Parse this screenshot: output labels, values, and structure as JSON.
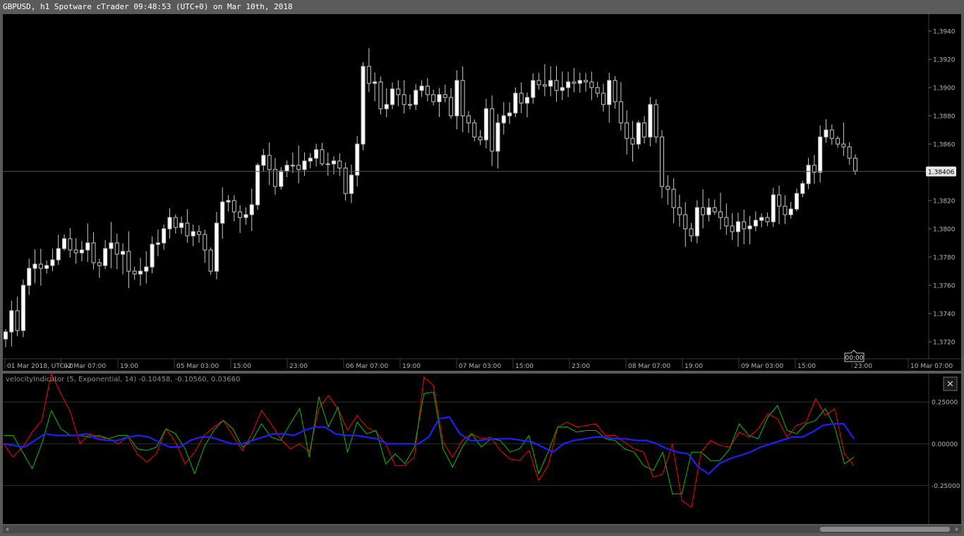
{
  "window": {
    "title": "GBPUSD, h1 Spotware cTrader 09:48:53 (UTC+0) on Mar 10th, 2018"
  },
  "colors": {
    "background": "#000000",
    "frame": "#5a5a5a",
    "candle_up": "#ffffff",
    "candle_down": "#000000",
    "wick": "#c8c8c8",
    "axis_text": "#b4b4b4",
    "fast_line": "#ff0000",
    "slow_line": "#00c000",
    "signal_line": "#1e1eff"
  },
  "chart_data": [
    {
      "type": "candlestick",
      "symbol": "GBPUSD",
      "timeframe": "h1",
      "ylim": [
        1.3708,
        1.3952
      ],
      "y_ticks": [
        "1,3720",
        "1,3740",
        "1,3760",
        "1,3780",
        "1,3800",
        "1,3820",
        "1,3840",
        "1,3860",
        "1,3880",
        "1,3900",
        "1,3920",
        "1,3940"
      ],
      "x_ticks": [
        "01 Mar 2018, UTC+0",
        "02 Mar 07:00",
        "19:00",
        "05 Mar 03:00",
        "15:00",
        "23:00",
        "06 Mar 07:00",
        "19:00",
        "07 Mar 03:00",
        "15:00",
        "23:00",
        "08 Mar 07:00",
        "19:00",
        "09 Mar 03:00",
        "15:00",
        "23:00",
        "10 Mar 07:00"
      ],
      "current_price": 1.38406,
      "current_price_label": "1.38406",
      "countdown_label": "00:00",
      "close": [
        1.3727,
        1.3742,
        1.3728,
        1.376,
        1.3772,
        1.3775,
        1.3772,
        1.3774,
        1.3778,
        1.3786,
        1.3793,
        1.3785,
        1.3783,
        1.3785,
        1.379,
        1.3776,
        1.3774,
        1.3786,
        1.379,
        1.3782,
        1.3784,
        1.377,
        1.3768,
        1.377,
        1.3773,
        1.3789,
        1.379,
        1.38,
        1.3808,
        1.3801,
        1.3804,
        1.3795,
        1.3798,
        1.3796,
        1.3785,
        1.377,
        1.3804,
        1.3819,
        1.382,
        1.3812,
        1.3808,
        1.381,
        1.3817,
        1.3845,
        1.3852,
        1.3842,
        1.383,
        1.3841,
        1.3845,
        1.3845,
        1.3842,
        1.3848,
        1.385,
        1.3856,
        1.3846,
        1.3846,
        1.3848,
        1.3843,
        1.3825,
        1.3838,
        1.386,
        1.3915,
        1.3903,
        1.3904,
        1.3885,
        1.3888,
        1.3899,
        1.3895,
        1.3888,
        1.3888,
        1.3898,
        1.3901,
        1.3895,
        1.389,
        1.3895,
        1.3893,
        1.388,
        1.3905,
        1.388,
        1.3875,
        1.3865,
        1.3863,
        1.3885,
        1.3855,
        1.3875,
        1.388,
        1.3882,
        1.3896,
        1.3889,
        1.3893,
        1.3905,
        1.3902,
        1.3901,
        1.3905,
        1.3898,
        1.39,
        1.3904,
        1.3903,
        1.3905,
        1.3904,
        1.39,
        1.3896,
        1.3888,
        1.3905,
        1.389,
        1.3875,
        1.3864,
        1.386,
        1.3875,
        1.3865,
        1.3888,
        1.3865,
        1.383,
        1.3828,
        1.3815,
        1.381,
        1.38,
        1.3795,
        1.3815,
        1.381,
        1.3815,
        1.3812,
        1.3808,
        1.3802,
        1.3798,
        1.3805,
        1.38,
        1.3802,
        1.3806,
        1.3808,
        1.3805,
        1.3824,
        1.3816,
        1.381,
        1.3814,
        1.3825,
        1.3832,
        1.3845,
        1.384,
        1.3865,
        1.387,
        1.3864,
        1.386,
        1.3858,
        1.385,
        1.3841
      ],
      "wick_span_range": [
        0.0004,
        0.0016
      ]
    },
    {
      "type": "line",
      "indicator": "velocityIndicator",
      "legend": "velocityIndicator (5, Exponential, 14) -0.10458, -0.10560, 0.03660",
      "ylim": [
        -0.48,
        0.42
      ],
      "y_ticks": [
        "0.25000",
        "0.00000",
        "-0.25000"
      ],
      "series": [
        {
          "color": "#ff0000",
          "values": [
            0.0,
            -0.08,
            -0.02,
            0.07,
            0.14,
            0.42,
            0.3,
            0.19,
            0.0,
            0.06,
            0.04,
            0.03,
            0.0,
            0.04,
            -0.06,
            -0.11,
            -0.06,
            0.09,
            0.01,
            -0.12,
            -0.05,
            0.05,
            0.1,
            0.14,
            0.05,
            -0.04,
            0.06,
            0.2,
            0.12,
            0.03,
            -0.03,
            0.0,
            -0.05,
            0.21,
            0.29,
            0.21,
            0.08,
            0.17,
            0.1,
            0.07,
            0.0,
            -0.13,
            -0.13,
            -0.08,
            0.4,
            0.35,
            0.01,
            -0.08,
            0.02,
            0.06,
            0.03,
            0.04,
            -0.04,
            -0.09,
            -0.1,
            -0.04,
            -0.22,
            -0.13,
            0.1,
            0.13,
            0.1,
            0.11,
            0.12,
            0.05,
            0.05,
            0.01,
            -0.03,
            -0.05,
            -0.2,
            -0.18,
            0.0,
            -0.34,
            -0.38,
            -0.05,
            0.02,
            -0.01,
            -0.02,
            0.07,
            0.04,
            0.09,
            0.18,
            0.15,
            0.04,
            0.11,
            0.13,
            0.27,
            0.17,
            0.21,
            -0.06,
            -0.13
          ]
        },
        {
          "color": "#00c000",
          "values": [
            0.05,
            0.05,
            -0.05,
            -0.15,
            0.0,
            0.2,
            0.09,
            0.05,
            0.05,
            0.04,
            0.05,
            0.03,
            0.05,
            0.05,
            -0.03,
            -0.04,
            -0.02,
            0.09,
            0.06,
            -0.03,
            -0.18,
            -0.02,
            0.08,
            0.14,
            0.09,
            -0.02,
            0.02,
            0.12,
            0.04,
            0.02,
            0.12,
            0.21,
            -0.08,
            0.28,
            0.1,
            0.22,
            -0.05,
            0.13,
            0.06,
            0.08,
            -0.12,
            -0.06,
            -0.12,
            -0.02,
            0.3,
            0.31,
            -0.03,
            -0.14,
            -0.02,
            0.06,
            -0.02,
            0.03,
            0.02,
            -0.05,
            -0.03,
            0.05,
            -0.18,
            -0.05,
            0.1,
            0.1,
            0.07,
            0.08,
            0.08,
            0.03,
            0.02,
            -0.03,
            -0.05,
            -0.13,
            -0.16,
            -0.05,
            -0.3,
            -0.3,
            -0.05,
            -0.05,
            -0.1,
            -0.1,
            -0.03,
            0.12,
            0.05,
            0.03,
            0.16,
            0.23,
            0.08,
            0.06,
            0.12,
            0.14,
            0.21,
            0.1,
            -0.12,
            -0.08
          ]
        },
        {
          "color": "#1e1eff",
          "values": [
            0.0,
            -0.01,
            -0.02,
            0.02,
            0.06,
            0.05,
            0.05,
            0.05,
            0.06,
            0.03,
            0.02,
            0.02,
            0.04,
            0.05,
            0.04,
            0.01,
            -0.02,
            -0.02,
            0.02,
            0.04,
            0.04,
            0.02,
            0.0,
            0.0,
            0.02,
            0.04,
            0.06,
            0.06,
            0.05,
            0.08,
            0.1,
            0.1,
            0.06,
            0.05,
            0.05,
            0.04,
            0.03,
            0.0,
            0.0,
            0.0,
            0.0,
            0.04,
            0.15,
            0.16,
            0.06,
            0.02,
            0.02,
            0.03,
            0.03,
            0.03,
            0.02,
            0.01,
            -0.02,
            -0.05,
            0.0,
            0.02,
            0.03,
            0.04,
            0.04,
            0.03,
            0.03,
            0.02,
            0.02,
            0.0,
            -0.03,
            -0.05,
            -0.06,
            -0.14,
            -0.18,
            -0.12,
            -0.09,
            -0.07,
            -0.05,
            -0.02,
            0.0,
            0.02,
            0.04,
            0.04,
            0.07,
            0.11,
            0.12,
            0.12,
            0.03
          ]
        }
      ]
    }
  ],
  "icons": {
    "close_icon": "close-icon",
    "close_glyph": "✕"
  }
}
